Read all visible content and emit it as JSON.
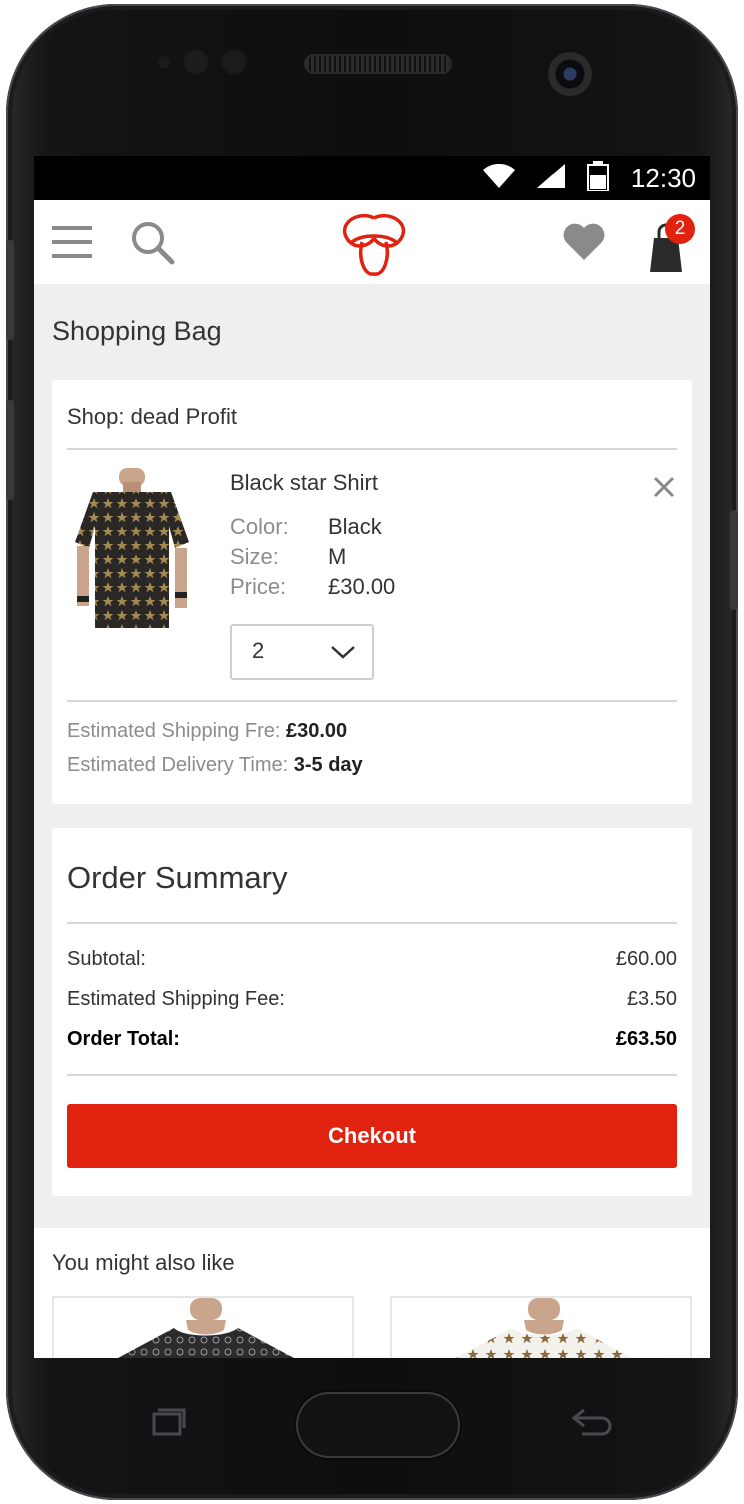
{
  "status_bar": {
    "time": "12:30"
  },
  "header": {
    "menu_icon": "hamburger-menu-icon",
    "search_icon": "search-icon",
    "logo": "trinity-knot-logo",
    "wishlist_icon": "heart-icon",
    "bag_icon": "shopping-bag-icon",
    "bag_count": "2"
  },
  "page": {
    "title": "Shopping Bag"
  },
  "bag": {
    "shop": "Shop: dead Profit",
    "item": {
      "name": "Black star Shirt",
      "color_label": "Color:",
      "color": "Black",
      "size_label": "Size:",
      "size": "M",
      "price_label": "Price:",
      "price": "£30.00",
      "quantity": "2"
    },
    "shipping_label": "Estimated Shipping Fre:",
    "shipping_value": "£30.00",
    "delivery_label": "Estimated Delivery Time:",
    "delivery_value": "3-5 day"
  },
  "summary": {
    "title": "Order Summary",
    "subtotal_label": "Subtotal:",
    "subtotal_value": "£60.00",
    "shipping_label": "Estimated Shipping Fee:",
    "shipping_value": "£3.50",
    "total_label": "Order Total:",
    "total_value": "£63.50",
    "checkout_label": "Chekout"
  },
  "recommendations": {
    "title": "You might also like"
  },
  "colors": {
    "accent": "#e0220e",
    "background": "#efefef",
    "text": "#333333",
    "muted": "#8c8c8c"
  }
}
